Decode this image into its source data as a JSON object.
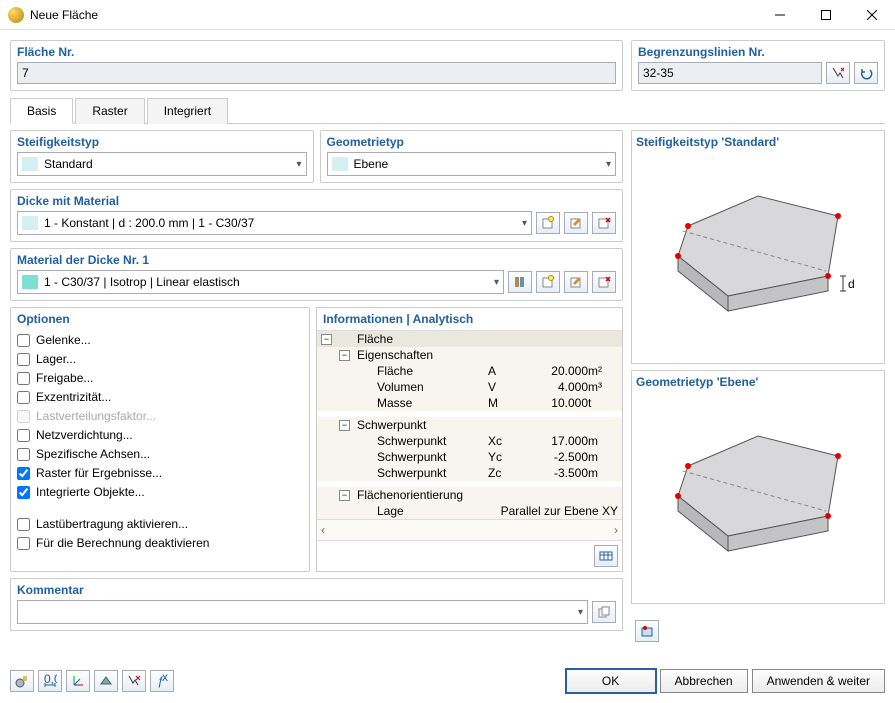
{
  "window": {
    "title": "Neue Fläche"
  },
  "surface_no": {
    "label": "Fläche Nr.",
    "value": "7"
  },
  "boundary": {
    "label": "Begrenzungslinien Nr.",
    "value": "32-35"
  },
  "tabs": {
    "basis": "Basis",
    "raster": "Raster",
    "integriert": "Integriert"
  },
  "stiffness": {
    "label": "Steifigkeitstyp",
    "value": "Standard"
  },
  "geometry": {
    "label": "Geometrietyp",
    "value": "Ebene"
  },
  "thickness": {
    "label": "Dicke mit Material",
    "value": "1 - Konstant | d : 200.0 mm | 1 - C30/37"
  },
  "material": {
    "label": "Material der Dicke Nr. 1",
    "value": "1 - C30/37 | Isotrop | Linear elastisch"
  },
  "options": {
    "label": "Optionen",
    "gelenke": "Gelenke...",
    "lager": "Lager...",
    "freigabe": "Freigabe...",
    "exz": "Exzentrizität...",
    "lastv": "Lastverteilungsfaktor...",
    "netz": "Netzverdichtung...",
    "spez": "Spezifische Achsen...",
    "raster": "Raster für Ergebnisse...",
    "integ": "Integrierte Objekte...",
    "lastu": "Lastübertragung aktivieren...",
    "deakt": "Für die Berechnung deaktivieren"
  },
  "info": {
    "header": "Informationen | Analytisch",
    "flaeche": "Fläche",
    "eigenschaften": "Eigenschaften",
    "flaeche_lbl": "Fläche",
    "flaeche_sym": "A",
    "flaeche_val": "20.000",
    "flaeche_unit": "m²",
    "volumen_lbl": "Volumen",
    "volumen_sym": "V",
    "volumen_val": "4.000",
    "volumen_unit": "m³",
    "masse_lbl": "Masse",
    "masse_sym": "M",
    "masse_val": "10.000",
    "masse_unit": "t",
    "schwerpunkt": "Schwerpunkt",
    "sx_lbl": "Schwerpunkt",
    "sx_sym": "Xc",
    "sx_val": "17.000",
    "sx_unit": "m",
    "sy_lbl": "Schwerpunkt",
    "sy_sym": "Yc",
    "sy_val": "-2.500",
    "sy_unit": "m",
    "sz_lbl": "Schwerpunkt",
    "sz_sym": "Zc",
    "sz_val": "-3.500",
    "sz_unit": "m",
    "orient": "Flächenorientierung",
    "lage_lbl": "Lage",
    "lage_val": "Parallel zur Ebene XY"
  },
  "preview": {
    "stiff_title": "Steifigkeitstyp 'Standard'",
    "geom_title": "Geometrietyp 'Ebene'"
  },
  "comment": {
    "label": "Kommentar"
  },
  "buttons": {
    "ok": "OK",
    "cancel": "Abbrechen",
    "apply": "Anwenden & weiter"
  }
}
